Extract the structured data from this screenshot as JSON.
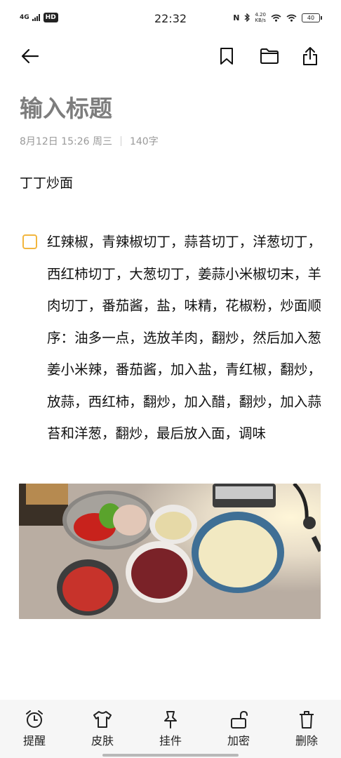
{
  "status_bar": {
    "network": "4G",
    "hd": "HD",
    "time": "22:32",
    "nfc": "N",
    "net_speed_value": "4.20",
    "net_speed_unit": "KB/s",
    "battery": "40"
  },
  "toolbar": {
    "back_icon": "arrow-left-icon",
    "bookmark_icon": "bookmark-icon",
    "folder_icon": "folder-icon",
    "share_icon": "share-icon"
  },
  "note": {
    "title_placeholder": "输入标题",
    "date": "8月12日 15:26 周三",
    "char_count": "140字",
    "first_line": "丁丁炒面",
    "checklist_item": "红辣椒，青辣椒切丁，蒜苔切丁，洋葱切丁，西红柿切丁，大葱切丁，姜蒜小米椒切末，羊肉切丁，番茄酱，盐，味精，花椒粉，炒面顺序：油多一点，选放羊肉，翻炒，然后加入葱姜小米辣，番茄酱，加入盐，青红椒，翻炒，放蒜，西红柿，翻炒，加入醋，翻炒，加入蒜苔和洋葱，翻炒，最后放入面，调味",
    "checkbox_color": "#f2b63e"
  },
  "bottom_bar": {
    "items": [
      {
        "label": "提醒",
        "icon": "alarm-clock-icon"
      },
      {
        "label": "皮肤",
        "icon": "shirt-icon"
      },
      {
        "label": "挂件",
        "icon": "pin-icon"
      },
      {
        "label": "加密",
        "icon": "unlock-icon"
      },
      {
        "label": "删除",
        "icon": "trash-icon"
      }
    ]
  }
}
